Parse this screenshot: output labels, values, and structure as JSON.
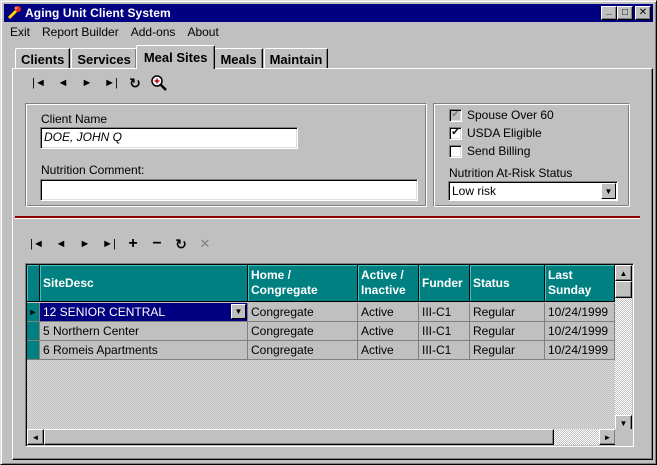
{
  "window": {
    "title": "Aging Unit Client System",
    "buttons": {
      "minimize": "_",
      "maximize": "□",
      "close": "✕"
    }
  },
  "menu": [
    "Exit",
    "Report Builder",
    "Add-ons",
    "About"
  ],
  "tabs": [
    {
      "label": "Clients",
      "active": false
    },
    {
      "label": "Services",
      "active": false
    },
    {
      "label": "Meal Sites",
      "active": true
    },
    {
      "label": "Meals",
      "active": false
    },
    {
      "label": "Maintain",
      "active": false
    }
  ],
  "top_nav": {
    "first": "|◄",
    "prev": "◄",
    "next": "►",
    "last": "►|",
    "refresh": "↻",
    "search": "search-zoom"
  },
  "client": {
    "name_label": "Client Name",
    "name_value": "DOE, JOHN Q",
    "comment_label": "Nutrition Comment:",
    "comment_value": ""
  },
  "options": {
    "spouse_over_60": {
      "label": "Spouse Over 60",
      "checked": true,
      "disabled": true
    },
    "usda_eligible": {
      "label": "USDA Eligible",
      "checked": true,
      "disabled": false
    },
    "send_billing": {
      "label": "Send Billing",
      "checked": false,
      "disabled": false
    },
    "risk_label": "Nutrition At-Risk Status",
    "risk_value": "Low risk"
  },
  "grid_nav": {
    "first": "|◄",
    "prev": "◄",
    "next": "►",
    "last": "►|",
    "add": "+",
    "remove": "−",
    "refresh": "↻",
    "cancel": "✕"
  },
  "grid": {
    "headers": [
      "SiteDesc",
      "Home / Congregate",
      "Active / Inactive",
      "Funder",
      "Status",
      "Last Sunday"
    ],
    "rows": [
      [
        "12 SENIOR CENTRAL",
        "Congregate",
        "Active",
        "III-C1",
        "Regular",
        "10/24/1999"
      ],
      [
        "5 Northern Center",
        "Congregate",
        "Active",
        "III-C1",
        "Regular",
        "10/24/1999"
      ],
      [
        "6 Romeis Apartments",
        "Congregate",
        "Active",
        "III-C1",
        "Regular",
        "10/24/1999"
      ]
    ],
    "current_row_marker": "►"
  },
  "colors": {
    "title": "#000080",
    "header": "#008080",
    "divider": "#8b0000",
    "face": "#c0c0c0"
  }
}
